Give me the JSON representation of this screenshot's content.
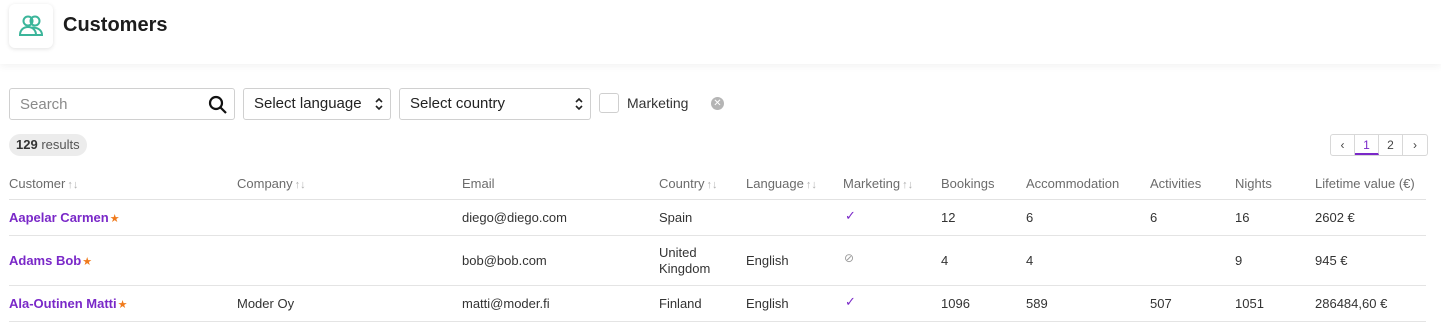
{
  "header": {
    "title": "Customers",
    "icon": "users-icon"
  },
  "filters": {
    "search_placeholder": "Search",
    "language_select": "Select language",
    "country_select": "Select country",
    "marketing_label": "Marketing"
  },
  "results": {
    "count": "129",
    "label": "results"
  },
  "pagination": {
    "prev": "‹",
    "pages": [
      "1",
      "2"
    ],
    "next": "›",
    "current": "1"
  },
  "table": {
    "columns": [
      "Customer",
      "Company",
      "Email",
      "Country",
      "Language",
      "Marketing",
      "Bookings",
      "Accommodation",
      "Activities",
      "Nights",
      "Lifetime value (€)"
    ],
    "rows": [
      {
        "customer": "Aapelar Carmen",
        "company": "",
        "email": "diego@diego.com",
        "country": "Spain",
        "language": "",
        "marketing": "yes",
        "bookings": "12",
        "accommodation": "6",
        "activities": "6",
        "nights": "16",
        "lifetime": "2602 €"
      },
      {
        "customer": "Adams Bob",
        "company": "",
        "email": "bob@bob.com",
        "country": "United Kingdom",
        "language": "English",
        "marketing": "no",
        "bookings": "4",
        "accommodation": "4",
        "activities": "",
        "nights": "9",
        "lifetime": "945 €"
      },
      {
        "customer": "Ala-Outinen Matti",
        "company": "Moder Oy",
        "email": "matti@moder.fi",
        "country": "Finland",
        "language": "English",
        "marketing": "yes",
        "bookings": "1096",
        "accommodation": "589",
        "activities": "507",
        "nights": "1051",
        "lifetime": "286484,60 €"
      }
    ]
  },
  "colors": {
    "accent": "#7a28c8",
    "star": "#f07a1b",
    "icon": "#3bb59a"
  }
}
